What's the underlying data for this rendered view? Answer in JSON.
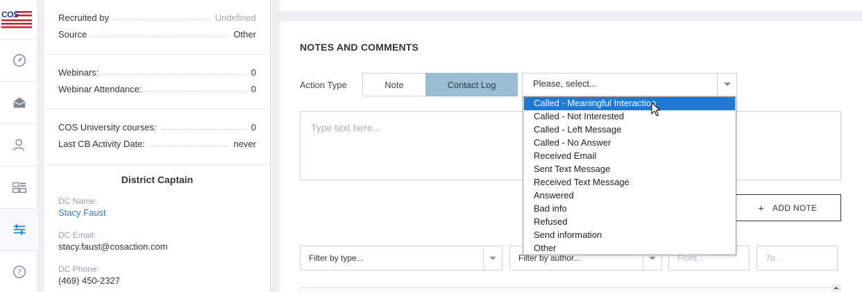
{
  "logo": {
    "text": "COS",
    "icon": "us-flag-logo"
  },
  "rail": {
    "items": [
      {
        "icon": "dashboard-icon"
      },
      {
        "icon": "mail-icon"
      },
      {
        "icon": "user-icon"
      },
      {
        "icon": "layout-icon"
      },
      {
        "icon": "tools-icon"
      },
      {
        "icon": "help-icon"
      }
    ]
  },
  "info": {
    "recruited_by_label": "Recruited by",
    "recruited_by_value": "Undefined",
    "source_label": "Source",
    "source_value": "Other",
    "webinars_label": "Webinars:",
    "webinars_value": "0",
    "webinar_attendance_label": "Webinar Attendance:",
    "webinar_attendance_value": "0",
    "courses_label": "COS University courses:",
    "courses_value": "0",
    "last_cb_label": "Last CB Activity Date:",
    "last_cb_value": "never"
  },
  "district_captain": {
    "title": "District Captain",
    "name_label": "DC Name:",
    "name": "Stacy Faust",
    "email_label": "DC Email:",
    "email": "stacy.faust@cosaction.com",
    "phone_label": "DC Phone:",
    "phone": "(469) 450-2327"
  },
  "notes": {
    "title": "NOTES AND COMMENTS",
    "action_type_label": "Action Type",
    "tab_note": "Note",
    "tab_contact_log": "Contact Log",
    "select_placeholder": "Please, select...",
    "text_placeholder": "Type text here...",
    "add_note_label": "ADD NOTE",
    "dropdown_options": [
      "Called - Meaningful Interaction",
      "Called - Not Interested",
      "Called - Left Message",
      "Called - No Answer",
      "Received Email",
      "Sent Text Message",
      "Received Text Message",
      "Answered",
      "Bad info",
      "Refused",
      "Send information",
      "Other"
    ],
    "highlighted_option": "Called - Meaningful Interaction"
  },
  "filters": {
    "type_placeholder": "Filter by type...",
    "author_placeholder": "Filter by author...",
    "from_placeholder": "From...",
    "to_placeholder": "To..."
  },
  "colors": {
    "active_tab": "#9bbdd3",
    "link": "#2e7bbf",
    "dropdown_highlight": "#1f78d4"
  }
}
